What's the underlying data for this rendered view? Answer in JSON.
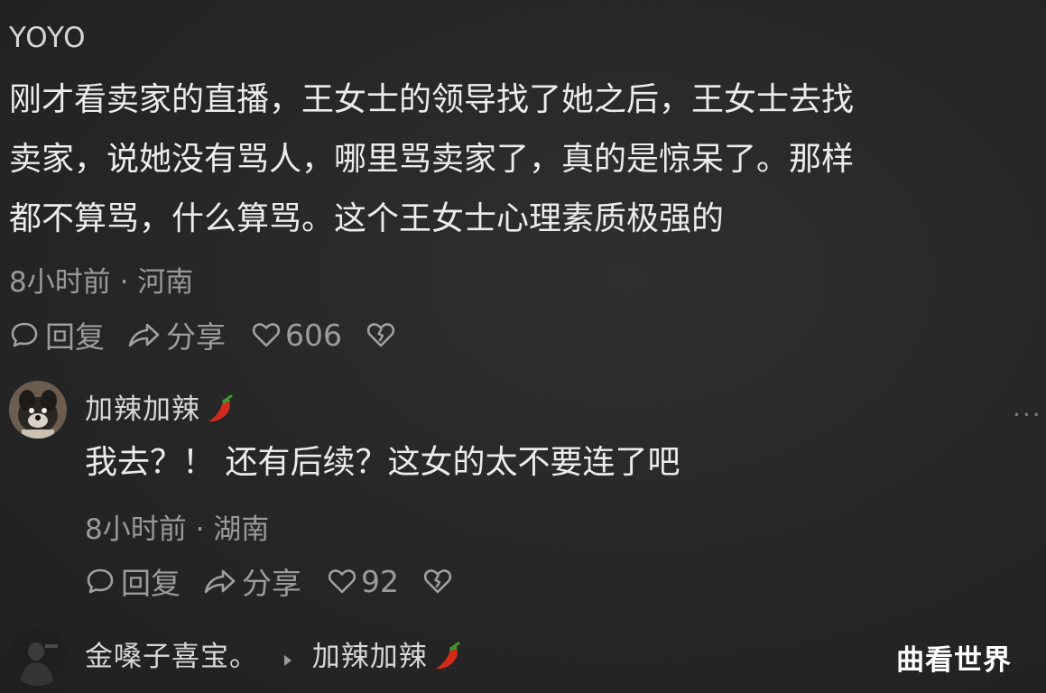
{
  "comment1": {
    "username": "YOYO",
    "text_lines": [
      "刚才看卖家的直播，王女士的领导找了她之后，王女士去找",
      "卖家，说她没有骂人，哪里骂卖家了，真的是惊呆了。那样",
      "都不算骂，什么算骂。这个王女士心理素质极强的"
    ],
    "meta": "8小时前 · 河南",
    "reply_label": "回复",
    "share_label": "分享",
    "likes": "606"
  },
  "comment2": {
    "username": "加辣加辣",
    "text": "我去？！ 还有后续？这女的太不要连了吧",
    "meta": "8小时前 · 湖南",
    "reply_label": "回复",
    "share_label": "分享",
    "likes": "92",
    "more": "···"
  },
  "comment3": {
    "username": "金嗓子喜宝。",
    "reply_to": "加辣加辣"
  },
  "watermark": "曲看世界",
  "icons": {
    "reply": "speech-bubble-icon",
    "share": "share-arrow-icon",
    "like": "heart-icon",
    "dislike": "broken-heart-icon",
    "chili": "chili-pepper-icon",
    "reply_arrow": "triangle-right-icon"
  }
}
